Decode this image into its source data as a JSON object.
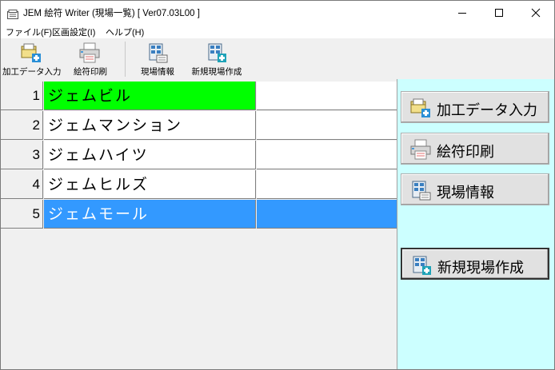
{
  "window": {
    "title": "JEM 絵符 Writer (現場一覧) [ Ver07.03L00 ]"
  },
  "menu": [
    {
      "label": "ファイル(F)"
    },
    {
      "label": "区画設定(I)"
    },
    {
      "label": "ヘルプ(H)"
    }
  ],
  "toolbar": {
    "buttons": [
      {
        "label": "加工データ入力",
        "icon": "folder-doc-icon"
      },
      {
        "label": "絵符印刷",
        "icon": "printer-icon"
      },
      {
        "label": "現場情報",
        "icon": "building-info-icon"
      },
      {
        "label": "新規現場作成",
        "icon": "building-add-icon"
      }
    ]
  },
  "grid": {
    "rows": [
      {
        "num": "1",
        "name": "ジェムビル",
        "bg": "#00ff00",
        "fg": "#000000"
      },
      {
        "num": "2",
        "name": "ジェムマンション",
        "bg": "#ffffff",
        "fg": "#000000"
      },
      {
        "num": "3",
        "name": "ジェムハイツ",
        "bg": "#ffffff",
        "fg": "#000000"
      },
      {
        "num": "4",
        "name": "ジェムヒルズ",
        "bg": "#ffffff",
        "fg": "#000000"
      },
      {
        "num": "5",
        "name": "ジェムモール",
        "bg": "#3399ff",
        "fg": "#ffffff",
        "selected": true
      }
    ]
  },
  "panel": {
    "buttons": [
      {
        "label": "加工データ入力"
      },
      {
        "label": "絵符印刷"
      },
      {
        "label": "現場情報"
      },
      {
        "label": "新規現場作成"
      }
    ]
  },
  "colors": {
    "panel_bg": "#ccffff",
    "highlight_green": "#00ff00",
    "selection_blue": "#3399ff"
  }
}
